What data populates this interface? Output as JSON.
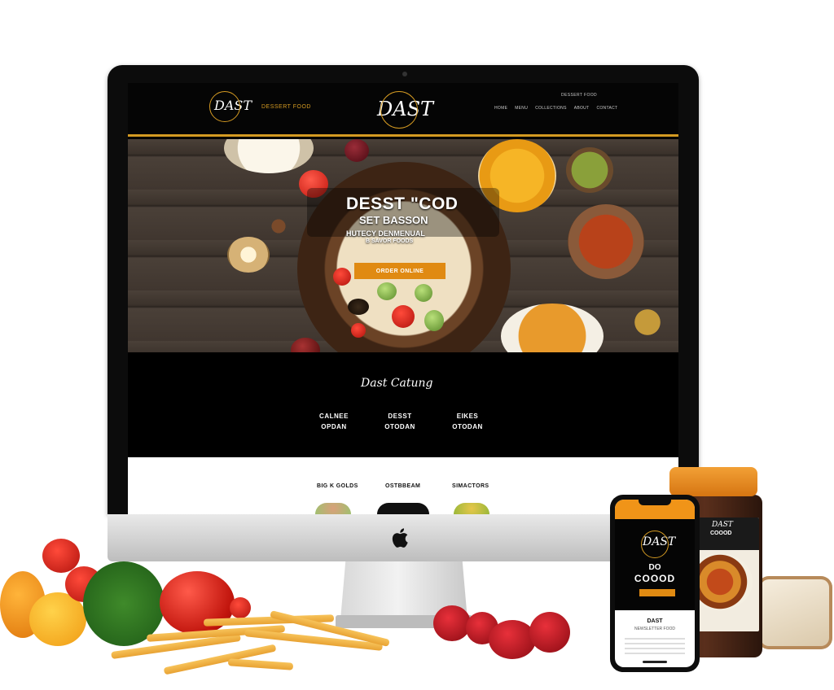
{
  "site": {
    "header": {
      "logo_small": "DAST",
      "header_tag": "DESSERT FOOD",
      "logo_main": "DAST",
      "top_right": "DESSERT FOOD",
      "nav": [
        "HOME",
        "MENU",
        "COLLECTIONS",
        "ABOUT",
        "CONTACT"
      ]
    },
    "hero": {
      "title": "DESST \"COD",
      "subtitle": "SET BASSON",
      "line1": "HUTECY DENMENUAL",
      "line2": "B SAVOR FOODS",
      "button": "ORDER ONLINE"
    },
    "collections": {
      "title": "Dast Catung",
      "items": [
        {
          "line1": "CALNEE",
          "line2": "OPDAN"
        },
        {
          "line1": "DESST",
          "line2": "OTODAN"
        },
        {
          "line1": "EIKES",
          "line2": "OTODAN"
        }
      ]
    },
    "section": {
      "items": [
        "BIG K GOLDS",
        "OSTBBEAM",
        "SIMACTORS"
      ]
    }
  },
  "phone": {
    "logo": "DAST",
    "big1": "DO",
    "big2": "COOOD",
    "section_title": "DAST",
    "section_sub": "NEWSLETTER FOOD"
  },
  "jar": {
    "label1": "DAST",
    "label2": "COOOD"
  },
  "colors": {
    "accent": "#d49a22",
    "button": "#e08a12",
    "dark": "#050505"
  }
}
